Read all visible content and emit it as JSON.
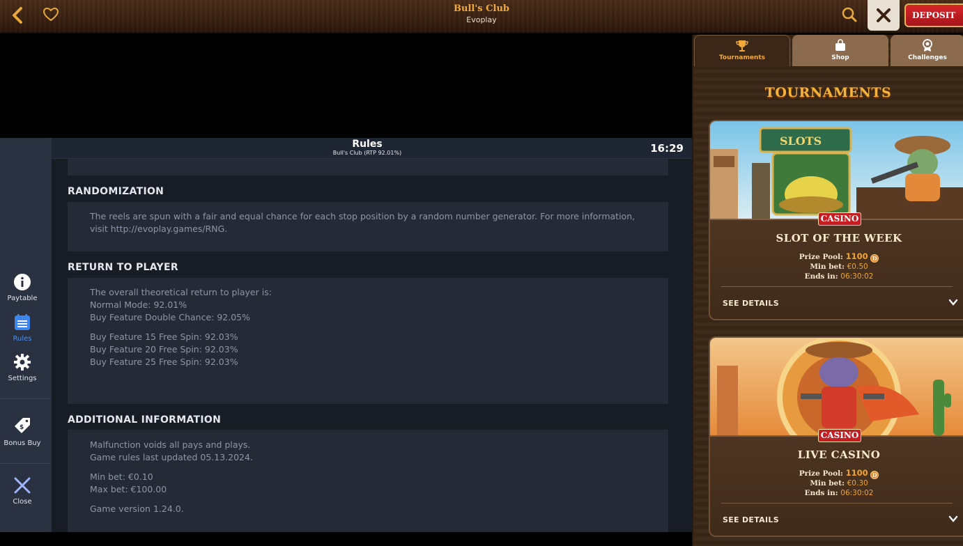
{
  "topbar": {
    "title": "Bull's Club",
    "provider": "Evoplay",
    "deposit_label": "DEPOSIT"
  },
  "rules_header": {
    "title": "Rules",
    "subtitle": "Bull's Club (RTP 92.01%)",
    "clock": "16:29"
  },
  "left_nav": {
    "paytable": "Paytable",
    "rules": "Rules",
    "settings": "Settings",
    "bonus_buy": "Bonus Buy",
    "close": "Close"
  },
  "sections": {
    "randomization": {
      "heading": "RANDOMIZATION",
      "lines": [
        "The reels are spun with a fair and equal chance for each stop position by a random number generator. For more information,",
        "visit http://evoplay.games/RNG."
      ]
    },
    "rtp": {
      "heading": "RETURN TO PLAYER",
      "lines": [
        "The overall theoretical return to player is:",
        "Normal Mode: 92.01%",
        "Buy Feature Double Chance: 92.05%",
        "Buy Feature 15 Free Spin: 92.03%",
        "Buy Feature 20 Free Spin: 92.03%",
        "Buy Feature 25 Free Spin: 92.03%"
      ]
    },
    "additional": {
      "heading": "ADDITIONAL INFORMATION",
      "lines": [
        "Malfunction voids all pays and plays.",
        "Game rules last updated 05.13.2024.",
        "Min bet: €0.10",
        "Max bet: €100.00",
        "Game version 1.24.0."
      ]
    }
  },
  "right_panel": {
    "tabs": {
      "tournaments": "Tournaments",
      "shop": "Shop",
      "challenges": "Challenges"
    },
    "heading": "TOURNAMENTS",
    "cards": [
      {
        "badge": "CASINO",
        "title": "SLOT OF THE WEEK",
        "prize_label": "Prize Pool:",
        "prize_value": "1100",
        "minbet_label": "Min bet:",
        "minbet_value": "€0.50",
        "ends_label": "Ends in:",
        "ends_value": "06:30:02",
        "details": "SEE DETAILS"
      },
      {
        "badge": "CASINO",
        "title": "LIVE CASINO",
        "prize_label": "Prize Pool:",
        "prize_value": "1100",
        "minbet_label": "Min bet:",
        "minbet_value": "€0.30",
        "ends_label": "Ends in:",
        "ends_value": "06:30:02",
        "details": "SEE DETAILS"
      }
    ]
  },
  "colors": {
    "accent_gold": "#f1a93a",
    "deposit_red": "#c41d22",
    "rules_bg": "#181c25",
    "nav_bg": "#2a3242"
  }
}
